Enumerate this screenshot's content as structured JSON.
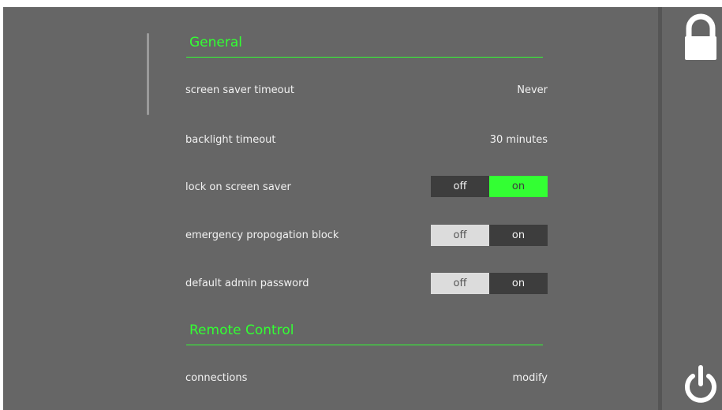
{
  "sections": [
    {
      "title": "General",
      "rows": [
        {
          "label": "screen saver timeout",
          "value": "Never"
        },
        {
          "label": "backlight timeout",
          "value": "30 minutes"
        },
        {
          "label": "lock on screen saver",
          "toggle": {
            "off_label": "off",
            "on_label": "on",
            "state": "on"
          }
        },
        {
          "label": "emergency propogation block",
          "toggle": {
            "off_label": "off",
            "on_label": "on",
            "state": "off"
          }
        },
        {
          "label": "default admin password",
          "toggle": {
            "off_label": "off",
            "on_label": "on",
            "state": "off"
          }
        }
      ]
    },
    {
      "title": "Remote Control",
      "rows": [
        {
          "label": "connections",
          "value": "modify"
        }
      ]
    }
  ],
  "sidebar": {
    "top_icon": "lock-icon",
    "bottom_icon": "power-icon"
  },
  "colors": {
    "accent": "#33ff33",
    "background": "#666666",
    "toggle_dark": "#3d3d3d",
    "toggle_light": "#dcdcdc"
  }
}
